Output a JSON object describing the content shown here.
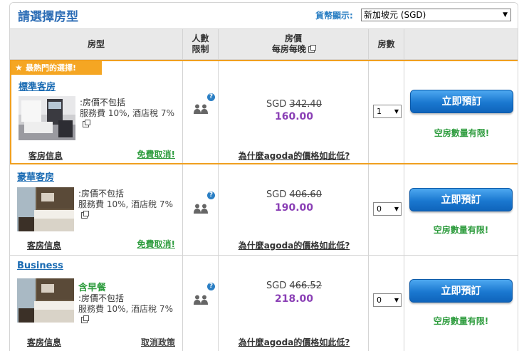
{
  "header": {
    "title": "請選擇房型",
    "currency_label": "貨幣顯示:",
    "currency_value": "新加坡元 (SGD)"
  },
  "columns": {
    "room_type": "房型",
    "occupancy_line1": "人數",
    "occupancy_line2": "限制",
    "price_line1": "房價",
    "price_line2": "每房每晚",
    "rooms": "房數"
  },
  "ribbon": "最熱門的選擇!",
  "rooms": [
    {
      "name": "標準客房",
      "breakfast": "",
      "desc1": ":房價不包括",
      "desc2": "服務費 10%, 酒店稅 7%",
      "currency": "SGD",
      "old_price": "342.40",
      "new_price": "160.00",
      "why_cheap": "為什麼agoda的價格如此低?",
      "qty": "1",
      "book_label": "立即預訂",
      "limited": "空房數量有限!",
      "info": "客房信息",
      "cancel": "免費取消!"
    },
    {
      "name": "豪華客房",
      "breakfast": "",
      "desc1": ":房價不包括",
      "desc2": "服務費 10%, 酒店稅 7%",
      "currency": "SGD",
      "old_price": "406.60",
      "new_price": "190.00",
      "why_cheap": "為什麼agoda的價格如此低?",
      "qty": "0",
      "book_label": "立即預訂",
      "limited": "空房數量有限!",
      "info": "客房信息",
      "cancel": "免費取消!"
    },
    {
      "name": "Business",
      "breakfast": "含早餐",
      "desc1": ":房價不包括",
      "desc2": "服務費 10%, 酒店稅 7%",
      "currency": "SGD",
      "old_price": "466.52",
      "new_price": "218.00",
      "why_cheap": "為什麼agoda的價格如此低?",
      "qty": "0",
      "book_label": "立即預訂",
      "limited": "空房數量有限!",
      "info": "客房信息",
      "cancel": "取消政策"
    }
  ],
  "icons": {
    "people": "people-icon",
    "help": "help-icon",
    "external": "external-link-icon",
    "star": "star-icon",
    "dropdown": "chevron-down-icon"
  },
  "colors": {
    "link_blue": "#1a6bb3",
    "ribbon_orange": "#f5a623",
    "price_purple": "#8a3fb5",
    "green": "#2e9c3e",
    "button_blue": "#1a78d0"
  }
}
